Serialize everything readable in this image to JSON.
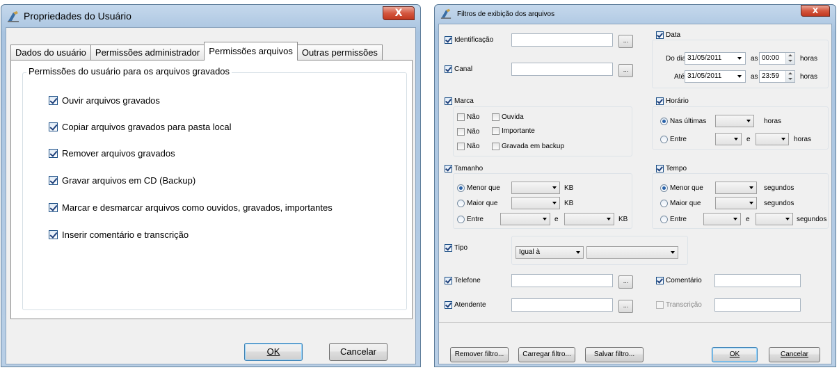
{
  "left": {
    "title": "Propriedades do Usuário",
    "close": "X",
    "tabs": [
      "Dados do usuário",
      "Permissões administrador",
      "Permissões arquivos",
      "Outras permissões"
    ],
    "active_tab": "Permissões arquivos",
    "group_title": "Permissões do usuário para os arquivos gravados",
    "permissions": [
      {
        "label": "Ouvir arquivos gravados",
        "checked": true
      },
      {
        "label": "Copiar arquivos gravados para pasta local",
        "checked": true
      },
      {
        "label": "Remover arquivos gravados",
        "checked": true
      },
      {
        "label": "Gravar arquivos em CD (Backup)",
        "checked": true
      },
      {
        "label": "Marcar e desmarcar arquivos como ouvidos, gravados, importantes",
        "checked": true
      },
      {
        "label": "Inserir comentário e transcrição",
        "checked": true
      }
    ],
    "ok": "OK",
    "cancel": "Cancelar"
  },
  "right": {
    "title": "Filtros de exibição dos arquivos",
    "close": "X",
    "identificacao": "Identificação",
    "canal": "Canal",
    "browse": "...",
    "data": "Data",
    "do_dia": "Do dia:",
    "ate": "Até:",
    "date_from": "31/05/2011",
    "date_to": "31/05/2011",
    "as": "as",
    "time_from": "00:00",
    "time_to": "23:59",
    "horas": "horas",
    "marca": "Marca",
    "nao": "Não",
    "ouvida": "Ouvida",
    "importante": "Importante",
    "gravada_backup": "Gravada em backup",
    "horario": "Horário",
    "nas_ultimas": "Nas últimas",
    "entre": "Entre",
    "e": "e",
    "tamanho": "Tamanho",
    "menor_que": "Menor que",
    "maior_que": "Maior que",
    "kb": "KB",
    "tempo": "Tempo",
    "segundos": "segundos",
    "tipo": "Tipo",
    "tipo_value": "Igual à",
    "telefone": "Telefone",
    "atendente": "Atendente",
    "comentario": "Comentário",
    "transcricao": "Transcrição",
    "remover_filtro": "Remover filtro...",
    "carregar_filtro": "Carregar filtro...",
    "salvar_filtro": "Salvar filtro...",
    "ok": "OK",
    "cancelar": "Cancelar"
  }
}
